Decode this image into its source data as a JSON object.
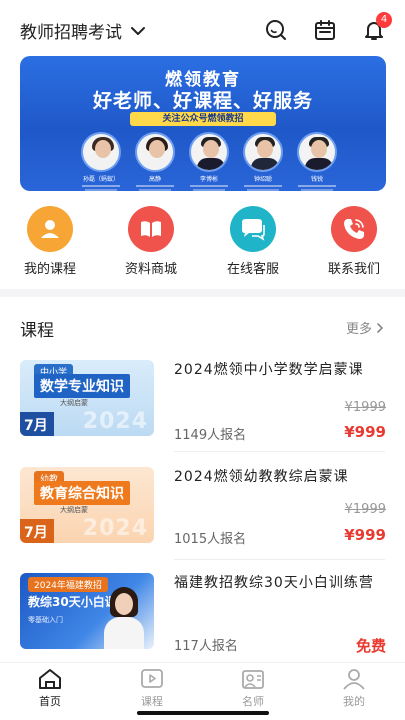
{
  "header": {
    "exam_type": "教师招聘考试",
    "chevron_icon": "chevron-down-icon",
    "search_icon": "search-icon",
    "calendar_icon": "calendar-icon",
    "bell_icon": "bell-icon",
    "notification_count": "4"
  },
  "banner": {
    "brand": "燃领教育",
    "slogan": "好老师、好课程、好服务",
    "tag": "关注公众号燃领教招",
    "teachers": [
      {
        "name": "孙磊（蚂蚁）"
      },
      {
        "name": "高静"
      },
      {
        "name": "李博彬"
      },
      {
        "name": "钟绍聪"
      },
      {
        "name": "钱锐"
      }
    ]
  },
  "quick_links": [
    {
      "label": "我的课程",
      "icon": "user-icon",
      "color": "#f7a534"
    },
    {
      "label": "资料商城",
      "icon": "book-icon",
      "color": "#f0534c"
    },
    {
      "label": "在线客服",
      "icon": "chat-icon",
      "color": "#20b4c8"
    },
    {
      "label": "联系我们",
      "icon": "phone-icon",
      "color": "#f0534c"
    }
  ],
  "courses_section": {
    "title": "课程",
    "more": "更多"
  },
  "courses": [
    {
      "title": "2024燃领中小学数学启蒙课",
      "original_price": "¥1999",
      "enrolled": "1149人报名",
      "price": "¥999",
      "thumb": {
        "tag": "中小学",
        "title": "数学专业知识",
        "sub": "大纲启蒙",
        "month": "7月",
        "year": "2024"
      }
    },
    {
      "title": "2024燃领幼教教综启蒙课",
      "original_price": "¥1999",
      "enrolled": "1015人报名",
      "price": "¥999",
      "thumb": {
        "tag": "幼教",
        "title": "教育综合知识",
        "sub": "大纲启蒙",
        "month": "7月",
        "year": "2024"
      }
    },
    {
      "title": "福建教招教综30天小白训练营",
      "enrolled": "117人报名",
      "price": "免费",
      "thumb": {
        "tag": "2024年福建教招",
        "title": "教综30天小白课",
        "sub": "零基础入门"
      }
    }
  ],
  "tabbar": [
    {
      "label": "首页",
      "icon": "home-icon",
      "active": true
    },
    {
      "label": "课程",
      "icon": "play-icon",
      "active": false
    },
    {
      "label": "名师",
      "icon": "teacher-icon",
      "active": false
    },
    {
      "label": "我的",
      "icon": "profile-icon",
      "active": false
    }
  ]
}
